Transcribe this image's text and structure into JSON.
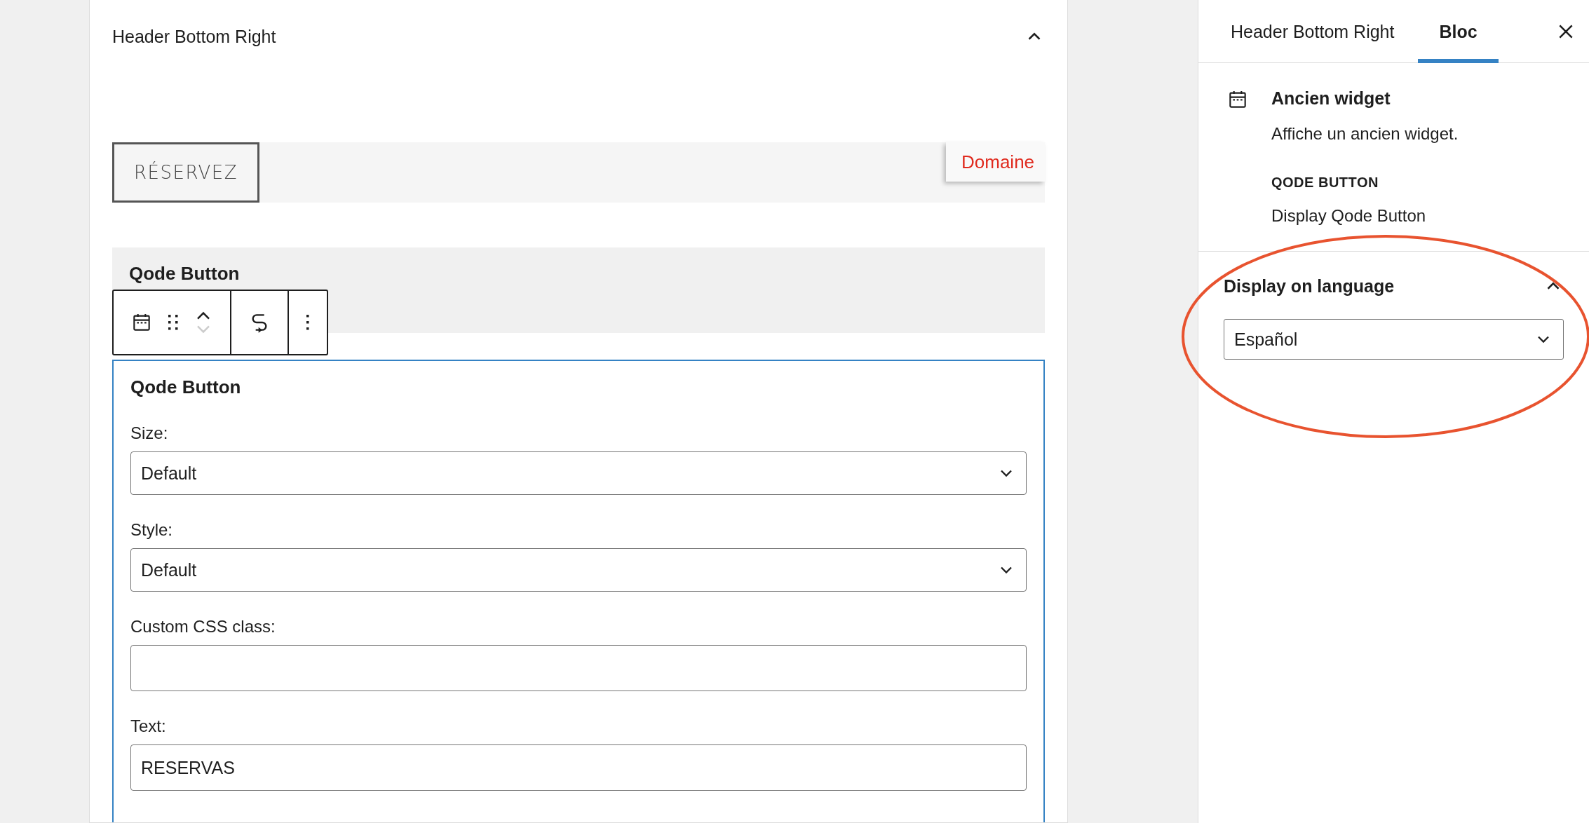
{
  "widget_area": {
    "title": "Header Bottom Right",
    "expanded": true,
    "preview": {
      "button_label": "RÉSERVEZ",
      "notice_text": "Domaine"
    },
    "block_preview": {
      "title": "Qode Button"
    },
    "toolbar": {
      "move_up_disabled": false,
      "move_down_disabled": true
    },
    "block_form": {
      "title": "Qode Button",
      "fields": [
        {
          "kind": "select",
          "label": "Size:",
          "value": "Default"
        },
        {
          "kind": "select",
          "label": "Style:",
          "value": "Default"
        },
        {
          "kind": "text",
          "label": "Custom CSS class:"
        },
        {
          "kind": "text",
          "label": "Text:",
          "value": "RESERVAS"
        }
      ]
    }
  },
  "sidebar": {
    "tabs": [
      {
        "label": "Header Bottom Right",
        "selected": false
      },
      {
        "label": "Bloc",
        "selected": true
      }
    ],
    "block_card": {
      "title": "Ancien widget",
      "description": "Affiche un ancien widget.",
      "widget_name": "QODE BUTTON",
      "widget_description": "Display Qode Button"
    },
    "language_panel": {
      "title": "Display on language",
      "expanded": true,
      "value": "Español",
      "highlighted": true
    }
  }
}
